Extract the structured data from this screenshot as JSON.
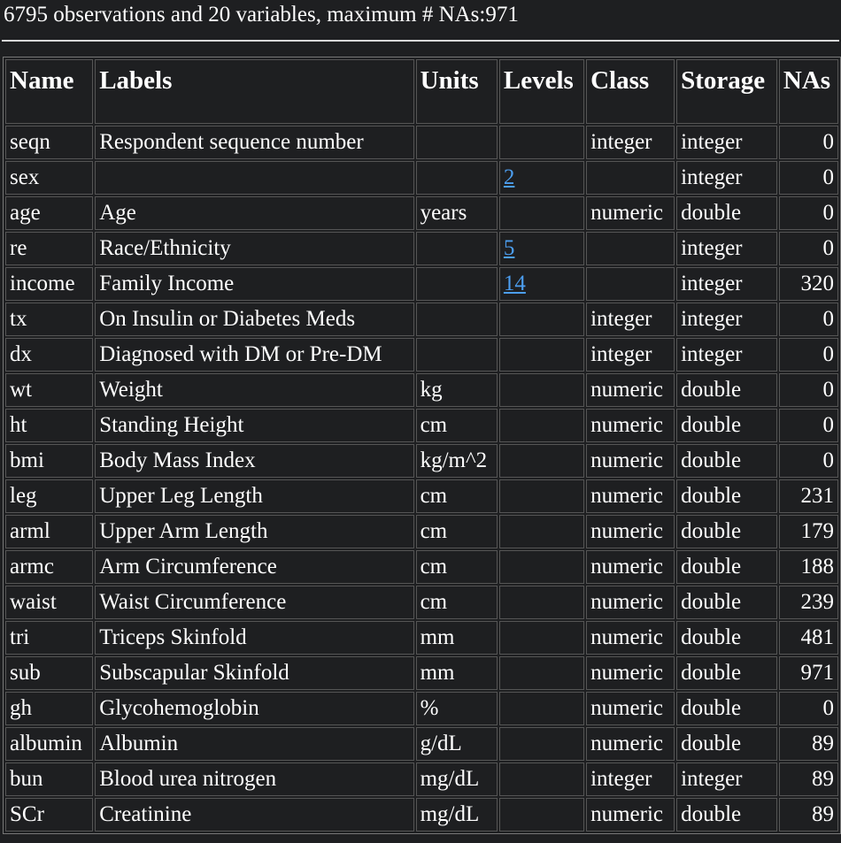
{
  "summary": "6795 observations and 20 variables, maximum # NAs:971",
  "columns": [
    "Name",
    "Labels",
    "Units",
    "Levels",
    "Class",
    "Storage",
    "NAs"
  ],
  "rows": [
    {
      "name": "seqn",
      "label": "Respondent sequence number",
      "units": "",
      "levels": "",
      "class": "integer",
      "storage": "integer",
      "nas": "0"
    },
    {
      "name": "sex",
      "label": "",
      "units": "",
      "levels": "2",
      "class": "",
      "storage": "integer",
      "nas": "0"
    },
    {
      "name": "age",
      "label": "Age",
      "units": "years",
      "levels": "",
      "class": "numeric",
      "storage": "double",
      "nas": "0"
    },
    {
      "name": "re",
      "label": "Race/Ethnicity",
      "units": "",
      "levels": "5",
      "class": "",
      "storage": "integer",
      "nas": "0"
    },
    {
      "name": "income",
      "label": "Family Income",
      "units": "",
      "levels": "14",
      "class": "",
      "storage": "integer",
      "nas": "320"
    },
    {
      "name": "tx",
      "label": "On Insulin or Diabetes Meds",
      "units": "",
      "levels": "",
      "class": "integer",
      "storage": "integer",
      "nas": "0"
    },
    {
      "name": "dx",
      "label": "Diagnosed with DM or Pre-DM",
      "units": "",
      "levels": "",
      "class": "integer",
      "storage": "integer",
      "nas": "0"
    },
    {
      "name": "wt",
      "label": "Weight",
      "units": "kg",
      "levels": "",
      "class": "numeric",
      "storage": "double",
      "nas": "0"
    },
    {
      "name": "ht",
      "label": "Standing Height",
      "units": "cm",
      "levels": "",
      "class": "numeric",
      "storage": "double",
      "nas": "0"
    },
    {
      "name": "bmi",
      "label": "Body Mass Index",
      "units": "kg/m^2",
      "levels": "",
      "class": "numeric",
      "storage": "double",
      "nas": "0"
    },
    {
      "name": "leg",
      "label": "Upper Leg Length",
      "units": "cm",
      "levels": "",
      "class": "numeric",
      "storage": "double",
      "nas": "231"
    },
    {
      "name": "arml",
      "label": "Upper Arm Length",
      "units": "cm",
      "levels": "",
      "class": "numeric",
      "storage": "double",
      "nas": "179"
    },
    {
      "name": "armc",
      "label": "Arm Circumference",
      "units": "cm",
      "levels": "",
      "class": "numeric",
      "storage": "double",
      "nas": "188"
    },
    {
      "name": "waist",
      "label": "Waist Circumference",
      "units": "cm",
      "levels": "",
      "class": "numeric",
      "storage": "double",
      "nas": "239"
    },
    {
      "name": "tri",
      "label": "Triceps Skinfold",
      "units": "mm",
      "levels": "",
      "class": "numeric",
      "storage": "double",
      "nas": "481"
    },
    {
      "name": "sub",
      "label": "Subscapular Skinfold",
      "units": "mm",
      "levels": "",
      "class": "numeric",
      "storage": "double",
      "nas": "971"
    },
    {
      "name": "gh",
      "label": "Glycohemoglobin",
      "units": "%",
      "levels": "",
      "class": "numeric",
      "storage": "double",
      "nas": "0"
    },
    {
      "name": "albumin",
      "label": "Albumin",
      "units": "g/dL",
      "levels": "",
      "class": "numeric",
      "storage": "double",
      "nas": "89"
    },
    {
      "name": "bun",
      "label": "Blood urea nitrogen",
      "units": "mg/dL",
      "levels": "",
      "class": "integer",
      "storage": "integer",
      "nas": "89"
    },
    {
      "name": "SCr",
      "label": "Creatinine",
      "units": "mg/dL",
      "levels": "",
      "class": "numeric",
      "storage": "double",
      "nas": "89"
    }
  ],
  "colors": {
    "background": "#1e1f21",
    "text": "#ffffff",
    "link": "#4c9ef0"
  }
}
